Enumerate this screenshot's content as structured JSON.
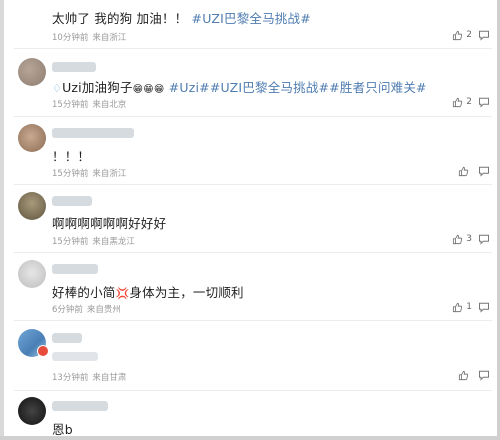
{
  "comments": [
    {
      "text": "太帅了 我的狗 加油！！",
      "tag": "#UZI巴黎全马挑战#",
      "time": "10分钟前",
      "location": "来自浙江",
      "likes": "2"
    },
    {
      "prefix_icon": "diamond-icon",
      "text_start": "Uzi加油狗子",
      "emoji": "😁😁😁",
      "tags": "#Uzi##UZI巴黎全马挑战##胜者只问难关#",
      "time": "15分钟前",
      "location": "来自北京",
      "likes": "2"
    },
    {
      "text": "！！！",
      "time": "15分钟前",
      "location": "来自浙江",
      "likes": ""
    },
    {
      "text": "啊啊啊啊啊啊好好好",
      "time": "15分钟前",
      "location": "来自黑龙江",
      "likes": "3"
    },
    {
      "text_start": "好棒的小简",
      "text_end": "身体为主，一切顺利",
      "time": "6分钟前",
      "location": "来自贵州",
      "likes": "1"
    },
    {
      "time": "13分钟前",
      "location": "来自甘肃",
      "likes": ""
    },
    {
      "text": "恩b"
    }
  ],
  "icons": {
    "like": "thumbs-up-icon",
    "reply": "comment-icon"
  },
  "colors": {
    "topic_link": "#4f7cb1",
    "meta_text": "#9a9a9a"
  }
}
